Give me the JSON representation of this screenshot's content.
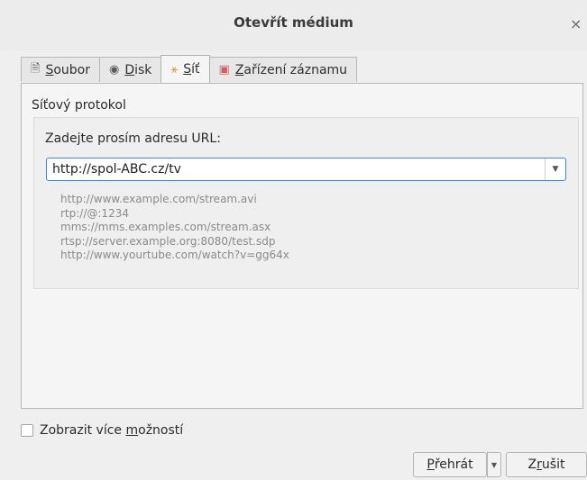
{
  "dialog": {
    "title": "Otevřít médium",
    "close_glyph": "×"
  },
  "tabs": [
    {
      "icon": "file-icon",
      "pre": "",
      "accel": "S",
      "post": "oubor",
      "active": false
    },
    {
      "icon": "disc-icon",
      "pre": "",
      "accel": "D",
      "post": "isk",
      "active": false
    },
    {
      "icon": "network-icon",
      "pre": "",
      "accel": "S",
      "post": "íť",
      "active": true
    },
    {
      "icon": "capture-device-icon",
      "pre": "",
      "accel": "Z",
      "post": "ařízení záznamu",
      "active": false
    }
  ],
  "network": {
    "group_title": "Síťový protokol",
    "url_label": "Zadejte prosím adresu URL:",
    "url_value": "http://spol-ABC.cz/tv",
    "examples": [
      "http://www.example.com/stream.avi",
      "rtp://@:1234",
      "mms://mms.examples.com/stream.asx",
      "rtsp://server.example.org:8080/test.sdp",
      "http://www.yourtube.com/watch?v=gg64x"
    ]
  },
  "options": {
    "pre": "Zobrazit více ",
    "accel": "m",
    "post": "ožností",
    "checked": false
  },
  "buttons": {
    "play_pre": "",
    "play_accel": "P",
    "play_post": "řehrát",
    "cancel_pre": "Z",
    "cancel_accel": "r",
    "cancel_post": "ušit"
  }
}
